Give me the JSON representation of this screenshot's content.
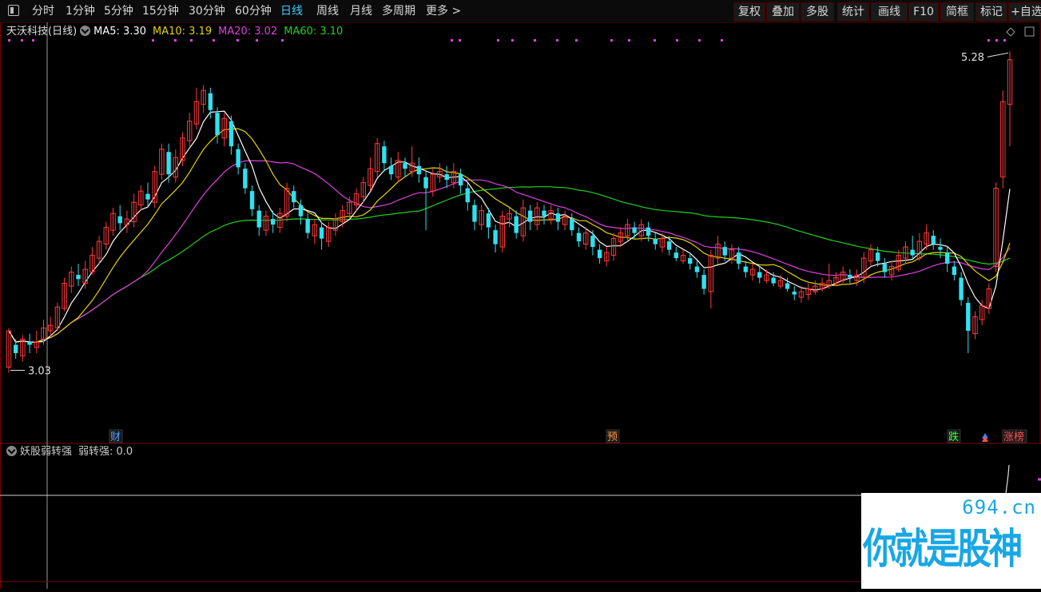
{
  "toolbar": {
    "periods": [
      "分时",
      "1分钟",
      "5分钟",
      "15分钟",
      "30分钟",
      "60分钟",
      "日线",
      "周线",
      "月线",
      "多周期",
      "更多 >"
    ],
    "active_period": "日线",
    "right_buttons": [
      "复权",
      "叠加",
      "多股",
      "统计",
      "画线",
      "F10",
      "简框",
      "标记",
      "+自选"
    ]
  },
  "stock": {
    "name": "天沃科技(日线)",
    "ma": [
      {
        "label": "MA5: 3.30",
        "color": "#ffffff"
      },
      {
        "label": "MA10: 3.19",
        "color": "#e6d200"
      },
      {
        "label": "MA20: 3.02",
        "color": "#e040e0"
      },
      {
        "label": "MA60: 3.10",
        "color": "#20d020"
      }
    ]
  },
  "price_annotations": {
    "high": "5.28",
    "low": "3.03"
  },
  "event_markers": [
    {
      "label": "财",
      "color": "#5aa0ff"
    },
    {
      "label": "预",
      "color": "#ff9a40"
    },
    {
      "label": "跌",
      "color": "#40ff40"
    },
    {
      "label": "涨榜",
      "color": "#ff5050"
    }
  ],
  "indicator": {
    "name": "妖股弱转强",
    "value_label": "弱转强: 0.0"
  },
  "watermark": {
    "domain": "694.cn",
    "slogan": "你就是股神"
  },
  "colors": {
    "up": "#ff3a3a",
    "down": "#30e0f0",
    "bg": "#000000"
  },
  "chart_data": {
    "type": "candlestick",
    "period": "daily",
    "ylim": [
      2.6,
      5.35
    ],
    "candles": [
      [
        3.02,
        3.28,
        3.3,
        2.98
      ],
      [
        3.18,
        3.12,
        3.22,
        3.08
      ],
      [
        3.1,
        3.22,
        3.25,
        3.06
      ],
      [
        3.2,
        3.18,
        3.26,
        3.12
      ],
      [
        3.16,
        3.2,
        3.28,
        3.12
      ],
      [
        3.22,
        3.3,
        3.36,
        3.18
      ],
      [
        3.28,
        3.32,
        3.38,
        3.24
      ],
      [
        3.3,
        3.45,
        3.48,
        3.28
      ],
      [
        3.44,
        3.62,
        3.66,
        3.42
      ],
      [
        3.6,
        3.7,
        3.74,
        3.55
      ],
      [
        3.68,
        3.65,
        3.76,
        3.6
      ],
      [
        3.62,
        3.72,
        3.78,
        3.58
      ],
      [
        3.7,
        3.82,
        3.88,
        3.68
      ],
      [
        3.8,
        3.92,
        3.96,
        3.76
      ],
      [
        3.9,
        4.02,
        4.06,
        3.86
      ],
      [
        4.0,
        4.12,
        4.16,
        3.96
      ],
      [
        4.1,
        4.05,
        4.18,
        4.0
      ],
      [
        4.04,
        4.08,
        4.14,
        3.98
      ],
      [
        4.06,
        4.2,
        4.26,
        4.02
      ],
      [
        4.18,
        4.28,
        4.32,
        4.14
      ],
      [
        4.26,
        4.22,
        4.34,
        4.16
      ],
      [
        4.2,
        4.42,
        4.46,
        4.16
      ],
      [
        4.4,
        4.58,
        4.62,
        4.36
      ],
      [
        4.56,
        4.4,
        4.62,
        4.34
      ],
      [
        4.38,
        4.52,
        4.58,
        4.34
      ],
      [
        4.5,
        4.66,
        4.7,
        4.46
      ],
      [
        4.64,
        4.78,
        4.84,
        4.6
      ],
      [
        4.76,
        4.92,
        5.02,
        4.72
      ],
      [
        4.9,
        5.0,
        5.04,
        4.84
      ],
      [
        4.98,
        4.86,
        5.02,
        4.8
      ],
      [
        4.84,
        4.68,
        4.88,
        4.62
      ],
      [
        4.66,
        4.8,
        4.84,
        4.6
      ],
      [
        4.78,
        4.6,
        4.82,
        4.54
      ],
      [
        4.58,
        4.45,
        4.62,
        4.4
      ],
      [
        4.44,
        4.3,
        4.48,
        4.26
      ],
      [
        4.28,
        4.15,
        4.32,
        4.1
      ],
      [
        4.14,
        4.02,
        4.18,
        3.96
      ],
      [
        4.0,
        4.1,
        4.14,
        3.96
      ],
      [
        4.08,
        4.04,
        4.14,
        3.98
      ],
      [
        4.02,
        4.12,
        4.16,
        3.98
      ],
      [
        4.1,
        4.3,
        4.34,
        4.06
      ],
      [
        4.28,
        4.2,
        4.32,
        4.16
      ],
      [
        4.18,
        4.1,
        4.22,
        4.04
      ],
      [
        4.08,
        3.98,
        4.12,
        3.94
      ],
      [
        3.96,
        4.04,
        4.08,
        3.9
      ],
      [
        4.02,
        3.94,
        4.06,
        3.86
      ],
      [
        3.92,
        4.02,
        4.06,
        3.88
      ],
      [
        4.0,
        4.08,
        4.12,
        3.96
      ],
      [
        4.06,
        4.14,
        4.18,
        4.02
      ],
      [
        4.12,
        4.2,
        4.24,
        4.08
      ],
      [
        4.18,
        4.26,
        4.3,
        4.14
      ],
      [
        4.24,
        4.34,
        4.38,
        4.2
      ],
      [
        4.32,
        4.44,
        4.52,
        4.28
      ],
      [
        4.42,
        4.62,
        4.66,
        4.38
      ],
      [
        4.6,
        4.48,
        4.64,
        4.42
      ],
      [
        4.46,
        4.4,
        4.52,
        4.36
      ],
      [
        4.38,
        4.5,
        4.56,
        4.34
      ],
      [
        4.48,
        4.44,
        4.52,
        4.38
      ],
      [
        4.42,
        4.48,
        4.6,
        4.38
      ],
      [
        4.46,
        4.4,
        4.52,
        4.34
      ],
      [
        4.38,
        4.3,
        4.42,
        4.0
      ],
      [
        4.28,
        4.4,
        4.44,
        4.24
      ],
      [
        4.38,
        4.42,
        4.48,
        4.34
      ],
      [
        4.4,
        4.36,
        4.46,
        4.3
      ],
      [
        4.34,
        4.42,
        4.48,
        4.3
      ],
      [
        4.4,
        4.32,
        4.44,
        4.26
      ],
      [
        4.3,
        4.2,
        4.34,
        4.14
      ],
      [
        4.18,
        4.06,
        4.22,
        4.0
      ],
      [
        4.04,
        4.14,
        4.18,
        4.0
      ],
      [
        4.12,
        4.02,
        4.16,
        3.94
      ],
      [
        4.0,
        3.9,
        4.04,
        3.84
      ],
      [
        3.88,
        4.1,
        4.14,
        3.84
      ],
      [
        4.08,
        4.12,
        4.16,
        4.02
      ],
      [
        4.1,
        3.98,
        4.14,
        3.94
      ],
      [
        3.96,
        4.16,
        4.22,
        3.92
      ],
      [
        4.14,
        4.06,
        4.18,
        4.0
      ],
      [
        4.04,
        4.16,
        4.2,
        4.0
      ],
      [
        4.14,
        4.1,
        4.18,
        4.04
      ],
      [
        4.08,
        4.14,
        4.18,
        4.04
      ],
      [
        4.12,
        4.06,
        4.16,
        4.0
      ],
      [
        4.04,
        4.1,
        4.14,
        4.0
      ],
      [
        4.08,
        4.0,
        4.12,
        3.96
      ],
      [
        3.98,
        3.92,
        4.02,
        3.88
      ],
      [
        3.9,
        3.98,
        4.02,
        3.86
      ],
      [
        3.96,
        3.88,
        4.0,
        3.82
      ],
      [
        3.86,
        3.8,
        3.9,
        3.76
      ],
      [
        3.78,
        3.84,
        3.88,
        3.74
      ],
      [
        3.82,
        3.94,
        3.98,
        3.78
      ],
      [
        3.92,
        3.98,
        4.02,
        3.88
      ],
      [
        3.96,
        4.04,
        4.08,
        3.92
      ],
      [
        4.02,
        3.98,
        4.06,
        3.94
      ],
      [
        3.96,
        4.04,
        4.08,
        3.92
      ],
      [
        4.02,
        3.96,
        4.06,
        3.92
      ],
      [
        3.94,
        3.9,
        3.98,
        3.86
      ],
      [
        3.88,
        3.94,
        3.98,
        3.84
      ],
      [
        3.92,
        3.86,
        3.96,
        3.82
      ],
      [
        3.84,
        3.8,
        3.88,
        3.78
      ],
      [
        3.78,
        3.82,
        3.86,
        3.76
      ],
      [
        3.8,
        3.76,
        3.84,
        3.72
      ],
      [
        3.74,
        3.7,
        3.78,
        3.66
      ],
      [
        3.68,
        3.58,
        3.72,
        3.54
      ],
      [
        3.56,
        3.82,
        3.86,
        3.44
      ],
      [
        3.8,
        3.9,
        3.96,
        3.76
      ],
      [
        3.88,
        3.82,
        3.92,
        3.78
      ],
      [
        3.8,
        3.86,
        3.9,
        3.76
      ],
      [
        3.84,
        3.76,
        3.88,
        3.72
      ],
      [
        3.74,
        3.7,
        3.78,
        3.66
      ],
      [
        3.68,
        3.72,
        3.76,
        3.64
      ],
      [
        3.7,
        3.66,
        3.74,
        3.62
      ],
      [
        3.64,
        3.68,
        3.72,
        3.62
      ],
      [
        3.66,
        3.62,
        3.7,
        3.6
      ],
      [
        3.6,
        3.64,
        3.68,
        3.58
      ],
      [
        3.62,
        3.58,
        3.66,
        3.56
      ],
      [
        3.56,
        3.54,
        3.6,
        3.5
      ],
      [
        3.52,
        3.56,
        3.6,
        3.48
      ],
      [
        3.54,
        3.58,
        3.62,
        3.5
      ],
      [
        3.56,
        3.6,
        3.64,
        3.54
      ],
      [
        3.58,
        3.62,
        3.66,
        3.56
      ],
      [
        3.6,
        3.64,
        3.76,
        3.58
      ],
      [
        3.62,
        3.66,
        3.7,
        3.6
      ],
      [
        3.64,
        3.7,
        3.74,
        3.62
      ],
      [
        3.68,
        3.66,
        3.72,
        3.62
      ],
      [
        3.64,
        3.68,
        3.72,
        3.6
      ],
      [
        3.66,
        3.8,
        3.84,
        3.62
      ],
      [
        3.78,
        3.86,
        3.9,
        3.74
      ],
      [
        3.84,
        3.78,
        3.88,
        3.74
      ],
      [
        3.76,
        3.7,
        3.8,
        3.66
      ],
      [
        3.68,
        3.74,
        3.78,
        3.64
      ],
      [
        3.72,
        3.82,
        3.86,
        3.7
      ],
      [
        3.8,
        3.88,
        3.92,
        3.76
      ],
      [
        3.86,
        3.82,
        3.96,
        3.8
      ],
      [
        3.8,
        3.92,
        3.98,
        3.78
      ],
      [
        3.9,
        3.98,
        4.04,
        3.86
      ],
      [
        3.96,
        3.9,
        4.0,
        3.86
      ],
      [
        3.88,
        3.86,
        3.94,
        3.8
      ],
      [
        3.84,
        3.76,
        3.88,
        3.7
      ],
      [
        3.74,
        3.68,
        3.78,
        3.64
      ],
      [
        3.66,
        3.5,
        3.7,
        3.46
      ],
      [
        3.48,
        3.28,
        3.52,
        3.12
      ],
      [
        3.26,
        3.38,
        3.42,
        3.22
      ],
      [
        3.36,
        3.46,
        3.5,
        3.32
      ],
      [
        3.44,
        3.58,
        3.62,
        3.4
      ],
      [
        3.74,
        4.3,
        4.34,
        3.7
      ],
      [
        4.38,
        4.92,
        5.0,
        4.3
      ],
      [
        4.9,
        5.22,
        5.28,
        4.6
      ]
    ],
    "ma_series": [
      "MA5",
      "MA10",
      "MA20",
      "MA60"
    ]
  }
}
